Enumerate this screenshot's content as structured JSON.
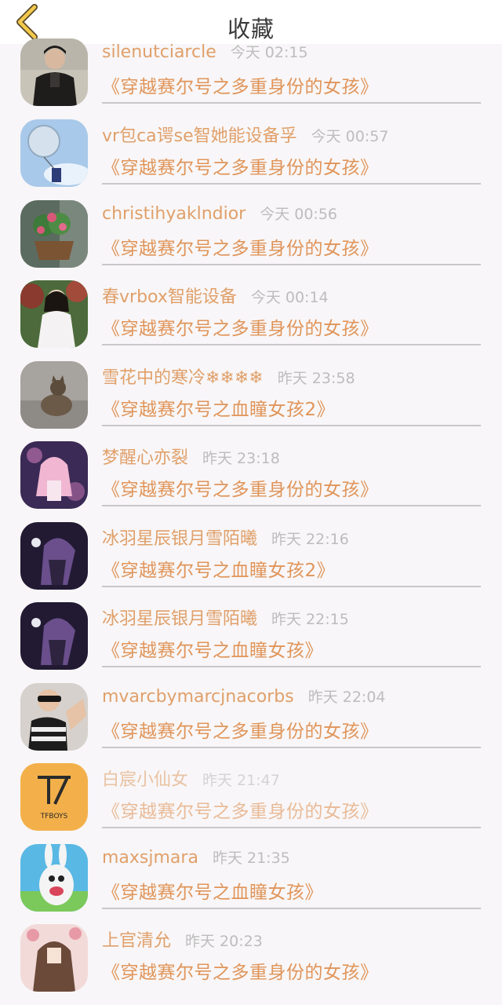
{
  "header": {
    "title": "收藏",
    "back_icon": "chevron-left-icon",
    "accent": "#f2c94c"
  },
  "items": [
    {
      "name": "silenutciarcle",
      "time": "今天 02:15",
      "book": "《穿越赛尔号之多重身份的女孩》",
      "avatar": "person-dark-coat"
    },
    {
      "name": "vr包ca谔se智她能设备孚",
      "time": "今天 00:57",
      "book": "《穿越赛尔号之多重身份的女孩》",
      "avatar": "glass-bell-sky"
    },
    {
      "name": "christihyaklndior",
      "time": "今天 00:56",
      "book": "《穿越赛尔号之多重身份的女孩》",
      "avatar": "flower-pot"
    },
    {
      "name": "春vrbox智能设备",
      "time": "今天 00:14",
      "book": "《穿越赛尔号之多重身份的女孩》",
      "avatar": "girl-white-dress"
    },
    {
      "name": "雪花中的寒冷❄❄❄❄",
      "time": "昨天 23:58",
      "book": "《穿越赛尔号之血瞳女孩2》",
      "avatar": "cat"
    },
    {
      "name": "梦醒心亦裂",
      "time": "昨天 23:18",
      "book": "《穿越赛尔号之多重身份的女孩》",
      "avatar": "anime-pink"
    },
    {
      "name": "冰羽星辰银月雪陌曦",
      "time": "昨天 22:16",
      "book": "《穿越赛尔号之血瞳女孩2》",
      "avatar": "anime-dark"
    },
    {
      "name": "冰羽星辰银月雪陌曦",
      "time": "昨天 22:15",
      "book": "《穿越赛尔号之血瞳女孩》",
      "avatar": "anime-dark"
    },
    {
      "name": "mvarcbymarcjnacorbs",
      "time": "昨天 22:04",
      "book": "《穿越赛尔号之多重身份的女孩》",
      "avatar": "person-sunglasses"
    },
    {
      "name": "白宸小仙女",
      "time": "昨天 21:47",
      "book": "《穿越赛尔号之多重身份的女孩》",
      "avatar": "tfboys-logo",
      "logo_text": "TFBOYS"
    },
    {
      "name": "maxsjmara",
      "time": "昨天 21:35",
      "book": "《穿越赛尔号之血瞳女孩》",
      "avatar": "rabbid"
    },
    {
      "name": "上官清允",
      "time": "昨天 20:23",
      "book": "《穿越赛尔号之多重身份的女孩》",
      "avatar": "anime-girl-flowers"
    }
  ]
}
